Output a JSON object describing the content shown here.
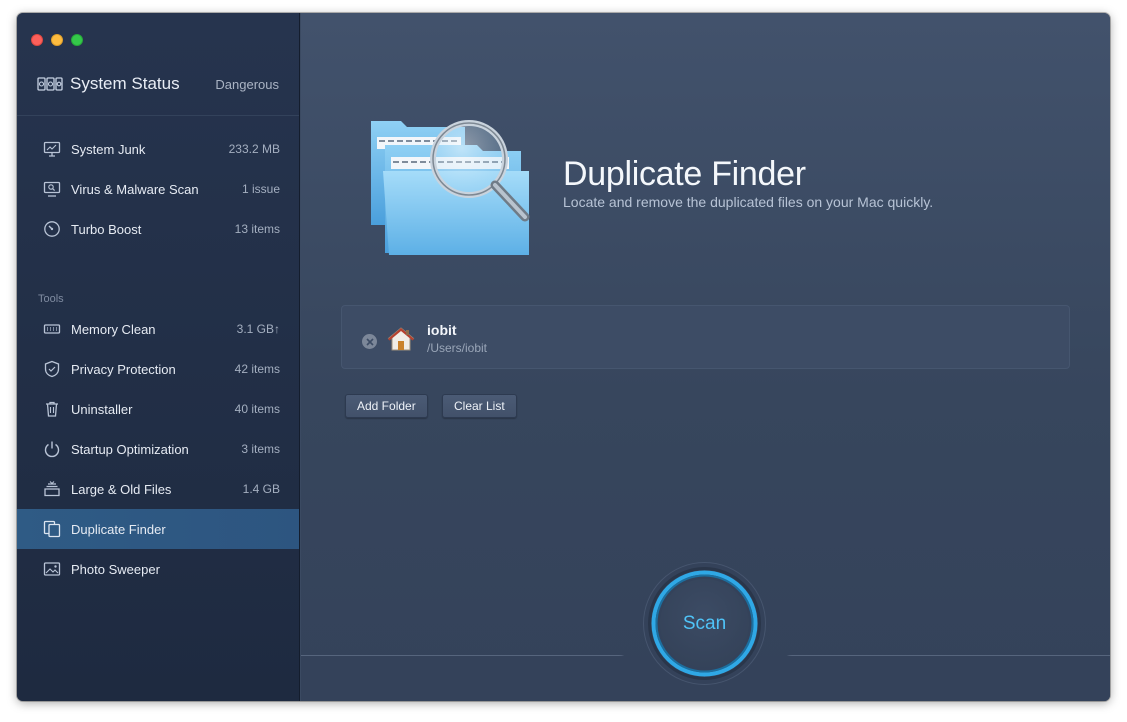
{
  "header": {
    "title": "System Status",
    "status": "Dangerous"
  },
  "sidebar": {
    "items": [
      {
        "label": "System Junk",
        "value": "233.2 MB"
      },
      {
        "label": "Virus & Malware Scan",
        "value": "1 issue"
      },
      {
        "label": "Turbo Boost",
        "value": "13 items"
      }
    ],
    "tools_label": "Tools",
    "tools": [
      {
        "label": "Memory Clean",
        "value": "3.1 GB↑"
      },
      {
        "label": "Privacy Protection",
        "value": "42 items"
      },
      {
        "label": "Uninstaller",
        "value": "40 items"
      },
      {
        "label": "Startup Optimization",
        "value": "3 items"
      },
      {
        "label": "Large & Old Files",
        "value": "1.4 GB"
      },
      {
        "label": "Duplicate Finder",
        "value": ""
      },
      {
        "label": "Photo Sweeper",
        "value": ""
      }
    ]
  },
  "main": {
    "title": "Duplicate Finder",
    "subtitle": "Locate and remove the duplicated files on your Mac quickly.",
    "folders": [
      {
        "name": "iobit",
        "path": "/Users/iobit"
      }
    ],
    "add_folder_label": "Add Folder",
    "clear_list_label": "Clear List",
    "scan_label": "Scan"
  },
  "colors": {
    "accent": "#4fc3f7",
    "active_item": "#2f5b85"
  }
}
